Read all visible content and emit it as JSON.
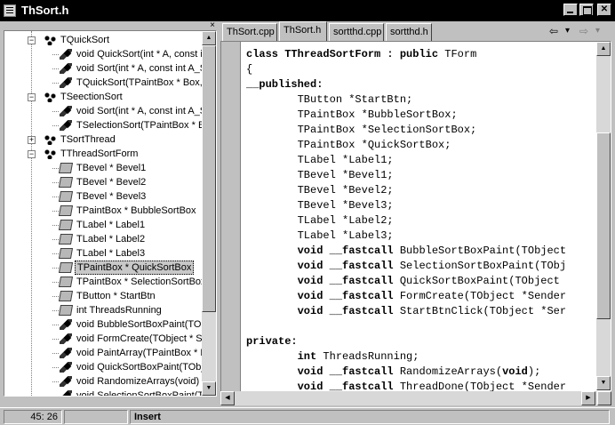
{
  "window": {
    "title": "ThSort.h"
  },
  "tree": {
    "close_glyph": "×",
    "items": [
      {
        "label": "TQuickSort",
        "kind": "class",
        "level": 0,
        "expanded": true
      },
      {
        "label": "void QuickSort(int * A, const in",
        "kind": "method",
        "level": 1
      },
      {
        "label": "void Sort(int * A, const int A_Si",
        "kind": "method",
        "level": 1
      },
      {
        "label": "TQuickSort(TPaintBox * Box, in",
        "kind": "method",
        "level": 1
      },
      {
        "label": "TSeectionSort",
        "kind": "class",
        "level": 0,
        "expanded": true
      },
      {
        "label": "void Sort(int * A, const int A_Si",
        "kind": "method",
        "level": 1
      },
      {
        "label": "TSelectionSort(TPaintBox * Box",
        "kind": "method",
        "level": 1
      },
      {
        "label": "TSortThread",
        "kind": "class",
        "level": 0,
        "expanded": false
      },
      {
        "label": "TThreadSortForm",
        "kind": "class",
        "level": 0,
        "expanded": true
      },
      {
        "label": "TBevel * Bevel1",
        "kind": "field",
        "level": 1
      },
      {
        "label": "TBevel * Bevel2",
        "kind": "field",
        "level": 1
      },
      {
        "label": "TBevel * Bevel3",
        "kind": "field",
        "level": 1
      },
      {
        "label": "TPaintBox * BubbleSortBox",
        "kind": "field",
        "level": 1
      },
      {
        "label": "TLabel * Label1",
        "kind": "field",
        "level": 1
      },
      {
        "label": "TLabel * Label2",
        "kind": "field",
        "level": 1
      },
      {
        "label": "TLabel * Label3",
        "kind": "field",
        "level": 1
      },
      {
        "label": "TPaintBox * QuickSortBox",
        "kind": "field",
        "level": 1,
        "selected": true
      },
      {
        "label": "TPaintBox * SelectionSortBox",
        "kind": "field",
        "level": 1
      },
      {
        "label": "TButton * StartBtn",
        "kind": "field",
        "level": 1
      },
      {
        "label": "int ThreadsRunning",
        "kind": "field",
        "level": 1
      },
      {
        "label": "void BubbleSortBoxPaint(TObj",
        "kind": "method",
        "level": 1
      },
      {
        "label": "void FormCreate(TObject * Ser",
        "kind": "method",
        "level": 1
      },
      {
        "label": "void PaintArray(TPaintBox * Bo",
        "kind": "method",
        "level": 1
      },
      {
        "label": "void QuickSortBoxPaint(TObje",
        "kind": "method",
        "level": 1
      },
      {
        "label": "void RandomizeArrays(void)",
        "kind": "method",
        "level": 1
      },
      {
        "label": "void SelectionSortBoxPaint(TO",
        "kind": "method",
        "level": 1
      }
    ]
  },
  "tabs": [
    {
      "label": "ThSort.cpp",
      "active": false
    },
    {
      "label": "ThSort.h",
      "active": true
    },
    {
      "label": "sortthd.cpp",
      "active": false
    },
    {
      "label": "sortthd.h",
      "active": false
    }
  ],
  "nav": {
    "back": "⇦",
    "back_drop": "▾",
    "forward": "⇨",
    "forward_drop": "▾"
  },
  "code": {
    "lines": [
      [
        {
          "t": "class",
          "b": true
        },
        {
          "t": " TThreadSortForm : ",
          "b": true
        },
        {
          "t": "public",
          "b": true
        },
        {
          "t": " TForm",
          "b": false
        }
      ],
      [
        {
          "t": "{",
          "b": false
        }
      ],
      [
        {
          "t": "__published:",
          "b": true
        }
      ],
      [
        {
          "t": "        TButton *StartBtn;",
          "b": false
        }
      ],
      [
        {
          "t": "        TPaintBox *BubbleSortBox;",
          "b": false
        }
      ],
      [
        {
          "t": "        TPaintBox *SelectionSortBox;",
          "b": false
        }
      ],
      [
        {
          "t": "        TPaintBox *QuickSortBox;",
          "b": false
        }
      ],
      [
        {
          "t": "        TLabel *Label1;",
          "b": false
        }
      ],
      [
        {
          "t": "        TBevel *Bevel1;",
          "b": false
        }
      ],
      [
        {
          "t": "        TBevel *Bevel2;",
          "b": false
        }
      ],
      [
        {
          "t": "        TBevel *Bevel3;",
          "b": false
        }
      ],
      [
        {
          "t": "        TLabel *Label2;",
          "b": false
        }
      ],
      [
        {
          "t": "        TLabel *Label3;",
          "b": false
        }
      ],
      [
        {
          "t": "        ",
          "b": false
        },
        {
          "t": "void",
          "b": true
        },
        {
          "t": " ",
          "b": false
        },
        {
          "t": "__fastcall",
          "b": true
        },
        {
          "t": " BubbleSortBoxPaint(TObject",
          "b": false
        }
      ],
      [
        {
          "t": "        ",
          "b": false
        },
        {
          "t": "void",
          "b": true
        },
        {
          "t": " ",
          "b": false
        },
        {
          "t": "__fastcall",
          "b": true
        },
        {
          "t": " SelectionSortBoxPaint(TObj",
          "b": false
        }
      ],
      [
        {
          "t": "        ",
          "b": false
        },
        {
          "t": "void",
          "b": true
        },
        {
          "t": " ",
          "b": false
        },
        {
          "t": "__fastcall",
          "b": true
        },
        {
          "t": " QuickSortBoxPaint(TObject",
          "b": false
        }
      ],
      [
        {
          "t": "        ",
          "b": false
        },
        {
          "t": "void",
          "b": true
        },
        {
          "t": " ",
          "b": false
        },
        {
          "t": "__fastcall",
          "b": true
        },
        {
          "t": " FormCreate(TObject *Sender",
          "b": false
        }
      ],
      [
        {
          "t": "        ",
          "b": false
        },
        {
          "t": "void",
          "b": true
        },
        {
          "t": " ",
          "b": false
        },
        {
          "t": "__fastcall",
          "b": true
        },
        {
          "t": " StartBtnClick(TObject *Ser",
          "b": false
        }
      ],
      [
        {
          "t": "",
          "b": false
        }
      ],
      [
        {
          "t": "private:",
          "b": true
        }
      ],
      [
        {
          "t": "        ",
          "b": false
        },
        {
          "t": "int",
          "b": true
        },
        {
          "t": " ThreadsRunning;",
          "b": false
        }
      ],
      [
        {
          "t": "        ",
          "b": false
        },
        {
          "t": "void",
          "b": true
        },
        {
          "t": " ",
          "b": false
        },
        {
          "t": "__fastcall",
          "b": true
        },
        {
          "t": " RandomizeArrays(",
          "b": false
        },
        {
          "t": "void",
          "b": true
        },
        {
          "t": ");",
          "b": false
        }
      ],
      [
        {
          "t": "        ",
          "b": false
        },
        {
          "t": "void",
          "b": true
        },
        {
          "t": " ",
          "b": false
        },
        {
          "t": "__fastcall",
          "b": true
        },
        {
          "t": " ThreadDone(TObject *Sender",
          "b": false
        }
      ]
    ]
  },
  "status": {
    "position": "45:  26",
    "mode": "",
    "insert": "Insert"
  }
}
